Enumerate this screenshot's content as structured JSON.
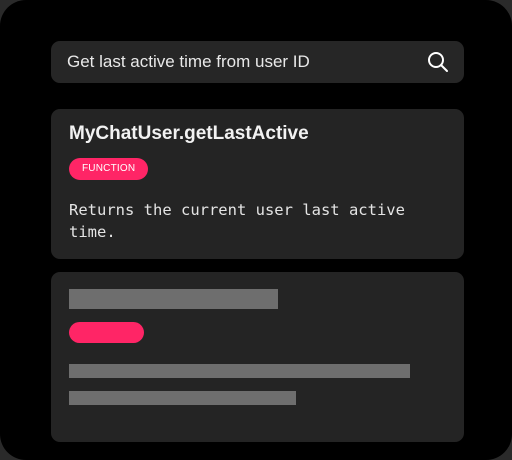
{
  "search": {
    "query": "Get last active time from user ID",
    "icon": "search-icon"
  },
  "result": {
    "title": "MyChatUser.getLastActive",
    "badge": "FUNCTION",
    "description": "Returns the current user last active time."
  },
  "colors": {
    "accent": "#ff2566",
    "background": "#000000",
    "card": "#242424",
    "skeleton": "#6e6e6e"
  }
}
